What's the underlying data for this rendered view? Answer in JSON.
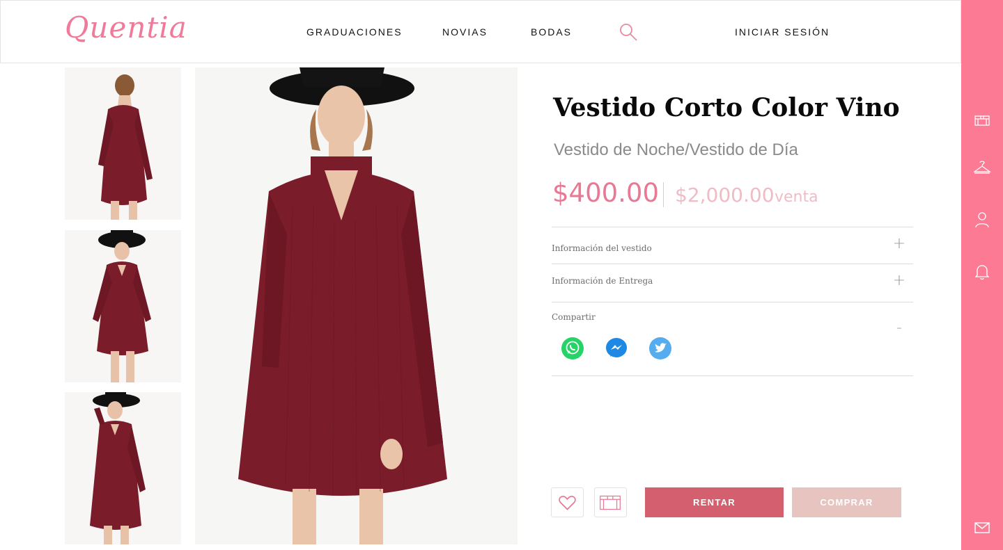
{
  "brand": {
    "logo_text": "Quentia",
    "accent": "#fc7a93"
  },
  "nav": {
    "items": [
      {
        "label": "GRADUACIONES"
      },
      {
        "label": "NOVIAS"
      },
      {
        "label": "BODAS"
      }
    ],
    "search_icon": "search-icon",
    "login_label": "INICIAR SESIÓN"
  },
  "rail": {
    "icons": [
      "box-icon",
      "hanger-icon",
      "user-icon",
      "bell-icon",
      "mail-icon"
    ]
  },
  "gallery": {
    "thumbnails": [
      "dress-back-view",
      "dress-front-hat",
      "dress-side-hat"
    ],
    "main_image": "dress-front-hat-main",
    "dress_color": "#7a1c2a"
  },
  "product": {
    "title": "Vestido Corto Color Vino",
    "subtitle": "Vestido de Noche/Vestido de Día",
    "rent_price": "$400.00",
    "sale_price": "$2,000.00",
    "sale_label": "venta"
  },
  "accordion": [
    {
      "label": "Información del vestido",
      "toggle": "+"
    },
    {
      "label": "Información de Entrega",
      "toggle": "+"
    },
    {
      "label": "Compartir",
      "toggle": "-"
    }
  ],
  "share": {
    "icons": [
      "whatsapp-icon",
      "messenger-icon",
      "twitter-icon"
    ],
    "colors": {
      "whatsapp": "#25d366",
      "messenger": "#1e88e5",
      "twitter": "#55acee"
    }
  },
  "actions": {
    "favorite_icon": "heart-icon",
    "box_icon": "box-icon",
    "rent_label": "RENTAR",
    "buy_label": "COMPRAR"
  }
}
